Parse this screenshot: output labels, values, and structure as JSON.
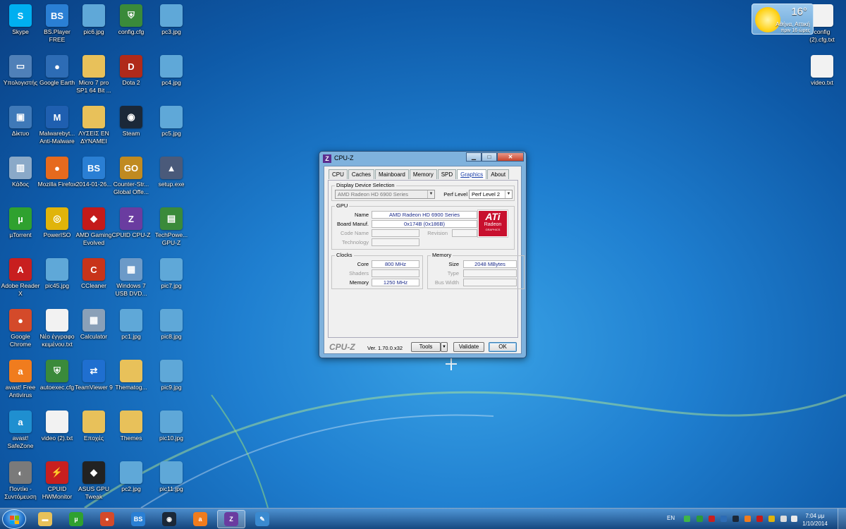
{
  "desktop": {
    "icons": [
      {
        "label": "Skype",
        "glyph": "S",
        "color": "#00aff0"
      },
      {
        "label": "BS.Player FREE",
        "glyph": "BS",
        "color": "#2a7fd4"
      },
      {
        "label": "pic6.jpg",
        "glyph": "",
        "color": "#5fa8d8"
      },
      {
        "label": "config.cfg",
        "glyph": "⛨",
        "color": "#3a8a3a"
      },
      {
        "label": "pc3.jpg",
        "glyph": "",
        "color": "#5fa8d8"
      },
      {
        "label": "Υπολογιστής",
        "glyph": "▭",
        "color": "#4f80b8"
      },
      {
        "label": "Google Earth",
        "glyph": "●",
        "color": "#2d6cb5"
      },
      {
        "label": "Micro 7 pro SP1 64 Bit ...",
        "glyph": "",
        "color": "#e8c15a"
      },
      {
        "label": "Dota 2",
        "glyph": "D",
        "color": "#b02a1a"
      },
      {
        "label": "pc4.jpg",
        "glyph": "",
        "color": "#5fa8d8"
      },
      {
        "label": "Δίκτυο",
        "glyph": "▣",
        "color": "#3f79b8"
      },
      {
        "label": "Malwarebyt... Anti-Malware",
        "glyph": "M",
        "color": "#1f5fb0"
      },
      {
        "label": "ΛΥΣΕΙΣ ΕΝ ΔΥΝΑΜΕΙ",
        "glyph": "",
        "color": "#e8c15a"
      },
      {
        "label": "Steam",
        "glyph": "◉",
        "color": "#1b2838"
      },
      {
        "label": "pc5.jpg",
        "glyph": "",
        "color": "#5fa8d8"
      },
      {
        "label": "Κάδος",
        "glyph": "▥",
        "color": "#8aa9c8"
      },
      {
        "label": "Mozilla Firefox",
        "glyph": "●",
        "color": "#e66a1e"
      },
      {
        "label": "2014-01-26...",
        "glyph": "BS",
        "color": "#2a7fd4"
      },
      {
        "label": "Counter-Str... Global Offe...",
        "glyph": "GO",
        "color": "#c08a20"
      },
      {
        "label": "setup.exe",
        "glyph": "▲",
        "color": "#4a5a7a"
      },
      {
        "label": "µTorrent",
        "glyph": "µ",
        "color": "#2fa12f"
      },
      {
        "label": "PowerISO",
        "glyph": "◎",
        "color": "#e0b40a"
      },
      {
        "label": "AMD Gaming Evolved",
        "glyph": "◆",
        "color": "#c41a1a"
      },
      {
        "label": "CPUID CPU-Z",
        "glyph": "Z",
        "color": "#6a3ca0"
      },
      {
        "label": "TechPowe... GPU-Z",
        "glyph": "▤",
        "color": "#3a8a3a"
      },
      {
        "label": "Adobe Reader X",
        "glyph": "A",
        "color": "#c81f1f"
      },
      {
        "label": "pic45.jpg",
        "glyph": "",
        "color": "#5fa8d8"
      },
      {
        "label": "CCleaner",
        "glyph": "C",
        "color": "#c8341a"
      },
      {
        "label": "Windows 7 USB DVD...",
        "glyph": "▦",
        "color": "#6c9ac8"
      },
      {
        "label": "pic7.jpg",
        "glyph": "",
        "color": "#5fa8d8"
      },
      {
        "label": "Google Chrome",
        "glyph": "●",
        "color": "#d44a2a"
      },
      {
        "label": "Νέο έγγραφο κειμένου.txt",
        "glyph": "",
        "color": "#f2f2f2"
      },
      {
        "label": "Calculator",
        "glyph": "▦",
        "color": "#8aa0b8"
      },
      {
        "label": "pc1.jpg",
        "glyph": "",
        "color": "#5fa8d8"
      },
      {
        "label": "pic8.jpg",
        "glyph": "",
        "color": "#5fa8d8"
      },
      {
        "label": "avast! Free Antivirus",
        "glyph": "a",
        "color": "#f07c1e"
      },
      {
        "label": "autoexec.cfg",
        "glyph": "⛨",
        "color": "#3a8a3a"
      },
      {
        "label": "TeamViewer 9",
        "glyph": "⇄",
        "color": "#1f6fd0"
      },
      {
        "label": "Thematog...",
        "glyph": "",
        "color": "#e8c15a"
      },
      {
        "label": "pic9.jpg",
        "glyph": "",
        "color": "#5fa8d8"
      },
      {
        "label": "avast! SafeZone",
        "glyph": "a",
        "color": "#1f8fd0"
      },
      {
        "label": "video (2).txt",
        "glyph": "",
        "color": "#f2f2f2"
      },
      {
        "label": "Εποχές",
        "glyph": "",
        "color": "#e8c15a"
      },
      {
        "label": "Themes",
        "glyph": "",
        "color": "#e8c15a"
      },
      {
        "label": "pic10.jpg",
        "glyph": "",
        "color": "#5fa8d8"
      },
      {
        "label": "Ποντίκι - Συντόμευση",
        "glyph": "◐",
        "color": "#7a7a7a"
      },
      {
        "label": "CPUID HWMonitor",
        "glyph": "⚡",
        "color": "#c81f1f"
      },
      {
        "label": "ASUS GPU Tweak",
        "glyph": "◆",
        "color": "#222222"
      },
      {
        "label": "pc2.jpg",
        "glyph": "",
        "color": "#5fa8d8"
      },
      {
        "label": "pic11.jpg",
        "glyph": "",
        "color": "#5fa8d8"
      }
    ],
    "right_icons": [
      {
        "label": "config (2).cfg.txt"
      },
      {
        "label": "video.txt"
      }
    ]
  },
  "weather": {
    "temp": "16°",
    "city": "Αθήνα, Αττική",
    "updated": "πριν 16 ώρες"
  },
  "cpuz": {
    "title": "CPU-Z",
    "tabs": [
      "CPU",
      "Caches",
      "Mainboard",
      "Memory",
      "SPD",
      "Graphics",
      "About"
    ],
    "active_tab": "Graphics",
    "display_section": "Display Device Selection",
    "device": "AMD Radeon HD 6900 Series",
    "perf_level_label": "Perf Level",
    "perf_level_value": "Perf Level 2",
    "gpu_section": "GPU",
    "labels": {
      "name": "Name",
      "board_manuf": "Board Manuf.",
      "code_name": "Code Name",
      "revision": "Revision",
      "technology": "Technology",
      "clocks": "Clocks",
      "core": "Core",
      "shaders": "Shaders",
      "memory_clock": "Memory",
      "memory": "Memory",
      "size": "Size",
      "type": "Type",
      "bus_width": "Bus Width"
    },
    "values": {
      "name": "AMD Radeon HD 6900 Series",
      "board_manuf": "0x174B (0x186B)",
      "core": "800 MHz",
      "memory_clock": "1250 MHz",
      "size": "2048 MBytes"
    },
    "logo": {
      "big": "ATi",
      "mid": "Radeon",
      "small": "GRAPHICS"
    },
    "brand": "CPU-Z",
    "version": "Ver. 1.70.0.x32",
    "tools": "Tools",
    "validate": "Validate",
    "ok": "OK"
  },
  "taskbar": {
    "apps": [
      {
        "name": "explorer",
        "glyph": "▬",
        "color": "#e8c15a",
        "active": false
      },
      {
        "name": "utorrent",
        "glyph": "µ",
        "color": "#2fa12f",
        "active": false
      },
      {
        "name": "chrome",
        "glyph": "●",
        "color": "#d44a2a",
        "active": false
      },
      {
        "name": "bsplayer",
        "glyph": "BS",
        "color": "#2a7fd4",
        "active": false
      },
      {
        "name": "steam",
        "glyph": "◉",
        "color": "#1b2838",
        "active": false
      },
      {
        "name": "avast",
        "glyph": "a",
        "color": "#f07c1e",
        "active": false
      },
      {
        "name": "cpuz",
        "glyph": "Z",
        "color": "#6a3ca0",
        "active": true
      },
      {
        "name": "paint",
        "glyph": "✎",
        "color": "#3a8ad0",
        "active": false
      }
    ],
    "language": "EN",
    "time": "7:04 μμ",
    "date": "1/10/2014"
  }
}
